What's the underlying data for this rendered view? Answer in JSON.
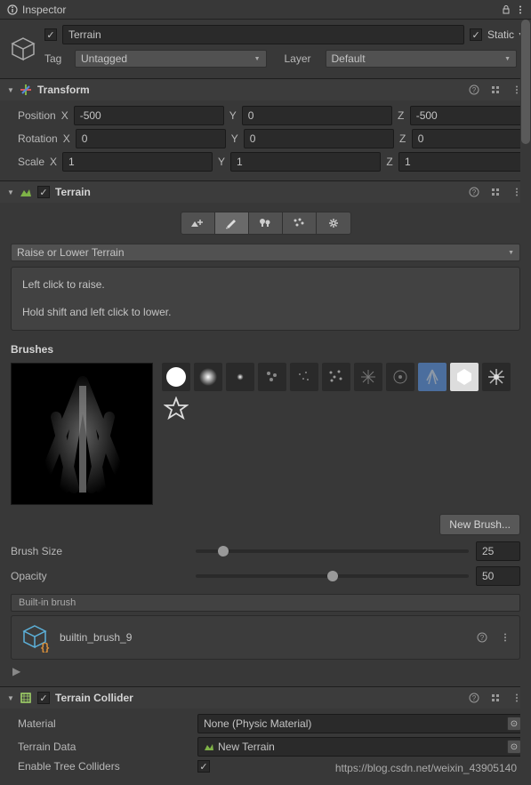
{
  "tab": {
    "title": "Inspector"
  },
  "object": {
    "enabled": true,
    "name": "Terrain",
    "static_label": "Static",
    "static_checked": true,
    "tag_label": "Tag",
    "tag_value": "Untagged",
    "layer_label": "Layer",
    "layer_value": "Default"
  },
  "transform": {
    "title": "Transform",
    "position_label": "Position",
    "rotation_label": "Rotation",
    "scale_label": "Scale",
    "px": "-500",
    "py": "0",
    "pz": "-500",
    "rx": "0",
    "ry": "0",
    "rz": "0",
    "sx": "1",
    "sy": "1",
    "sz": "1"
  },
  "terrain": {
    "title": "Terrain",
    "mode": "Raise or Lower Terrain",
    "help_line1": "Left click to raise.",
    "help_line2": "Hold shift and left click to lower.",
    "brushes_label": "Brushes",
    "new_brush_label": "New Brush...",
    "brush_size_label": "Brush Size",
    "brush_size_value": "25",
    "opacity_label": "Opacity",
    "opacity_value": "50",
    "info_bar": "Built-in brush",
    "asset_name": "builtin_brush_9"
  },
  "collider": {
    "title": "Terrain Collider",
    "material_label": "Material",
    "material_value": "None (Physic Material)",
    "terrain_data_label": "Terrain Data",
    "terrain_data_value": "New Terrain",
    "enable_tree_label": "Enable Tree Colliders",
    "enable_tree_checked": true
  },
  "axis": {
    "x": "X",
    "y": "Y",
    "z": "Z"
  },
  "watermark": "https://blog.csdn.net/weixin_43905140"
}
